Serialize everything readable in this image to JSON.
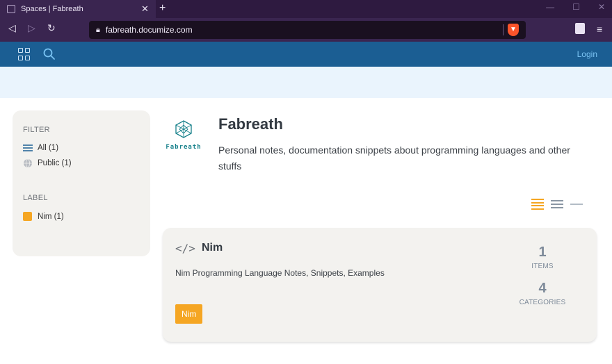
{
  "browser": {
    "tab_title": "Spaces | Fabreath",
    "url": "fabreath.documize.com"
  },
  "header": {
    "login_label": "Login"
  },
  "sidebar": {
    "filter_title": "FILTER",
    "filters": [
      {
        "label": "All (1)",
        "icon": "list-icon"
      },
      {
        "label": "Public (1)",
        "icon": "globe-icon"
      }
    ],
    "label_title": "LABEL",
    "labels": [
      {
        "label": "Nim (1)",
        "color": "#f5a623"
      }
    ]
  },
  "space": {
    "logo_text": "Fabreath",
    "title": "Fabreath",
    "description": "Personal notes, documentation snippets about programming languages and other stuffs"
  },
  "card": {
    "title": "Nim",
    "description": "Nim Programming Language Notes, Snippets, Examples",
    "tag": "Nim",
    "tag_color": "#f5a623",
    "items_count": "1",
    "items_label": "ITEMS",
    "categories_count": "4",
    "categories_label": "CATEGORIES"
  },
  "colors": {
    "accent_orange": "#f5a623",
    "header_blue": "#1b5e93",
    "login_blue": "#79c2f2"
  }
}
